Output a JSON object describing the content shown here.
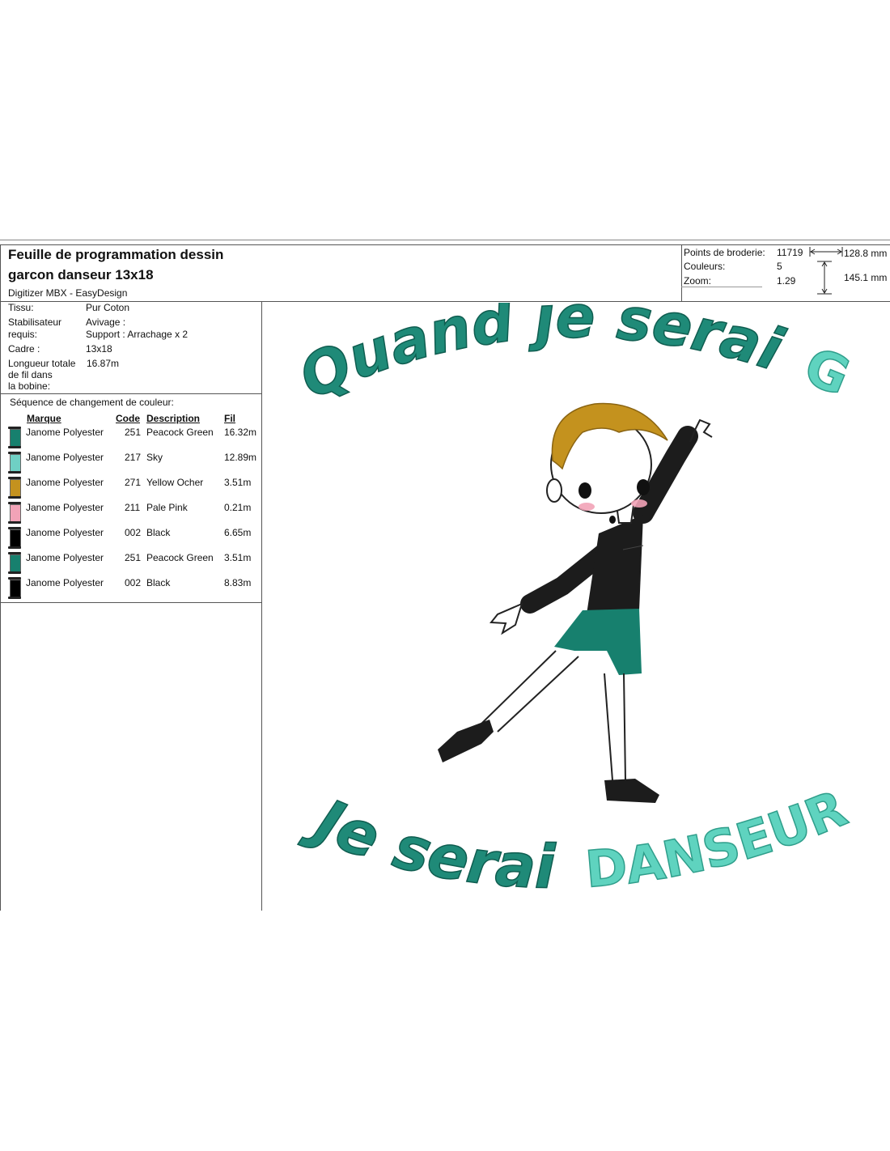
{
  "header": {
    "title_line1": "Feuille de programmation dessin",
    "title_line2": "garcon danseur 13x18",
    "software": "Digitizer MBX - EasyDesign"
  },
  "stats": {
    "stitches_label": "Points de broderie:",
    "stitches_value": "11719",
    "colors_label": "Couleurs:",
    "colors_value": "5",
    "zoom_label": "Zoom:",
    "zoom_value": "1.29",
    "width": "128.8 mm",
    "height": "145.1 mm"
  },
  "info": {
    "fabric_label": "Tissu:",
    "fabric_value": "Pur Coton",
    "stabilizer_label_1": "Stabilisateur",
    "stabilizer_label_2": "requis:",
    "stabilizer_value_1": "Avivage :",
    "stabilizer_value_2": "Support : Arrachage x 2",
    "frame_label": "Cadre :",
    "frame_value": "13x18",
    "thread_label_1": "Longueur totale",
    "thread_label_2": "de fil dans",
    "thread_label_3": "la bobine:",
    "thread_value": "16.87m"
  },
  "sequence": {
    "title": "Séquence de changement de couleur:",
    "headers": {
      "brand": "Marque",
      "code": "Code",
      "description": "Description",
      "thread": "Fil"
    },
    "rows": [
      {
        "brand": "Janome Polyester",
        "code": "251",
        "description": "Peacock Green",
        "thread": "16.32m",
        "color": "#17806e"
      },
      {
        "brand": "Janome Polyester",
        "code": "217",
        "description": "Sky",
        "thread": "12.89m",
        "color": "#6fd0c4"
      },
      {
        "brand": "Janome Polyester",
        "code": "271",
        "description": "Yellow Ocher",
        "thread": "3.51m",
        "color": "#c4921e"
      },
      {
        "brand": "Janome Polyester",
        "code": "211",
        "description": "Pale Pink",
        "thread": "0.21m",
        "color": "#f2a3b7"
      },
      {
        "brand": "Janome Polyester",
        "code": "002",
        "description": "Black",
        "thread": "6.65m",
        "color": "#000000"
      },
      {
        "brand": "Janome Polyester",
        "code": "251",
        "description": "Peacock Green",
        "thread": "3.51m",
        "color": "#17806e"
      },
      {
        "brand": "Janome Polyester",
        "code": "002",
        "description": "Black",
        "thread": "8.83m",
        "color": "#000000"
      }
    ]
  },
  "design": {
    "line1_a": "Quand je serai",
    "line1_b": "GRAND",
    "line2_a": "Je serai",
    "line2_b": "DANSEUR",
    "color_dark": "#1f8a78",
    "color_light": "#5fd3bf",
    "hair_color": "#c4921e",
    "shirt_color": "#1c1c1c",
    "shorts_color": "#17806e"
  }
}
